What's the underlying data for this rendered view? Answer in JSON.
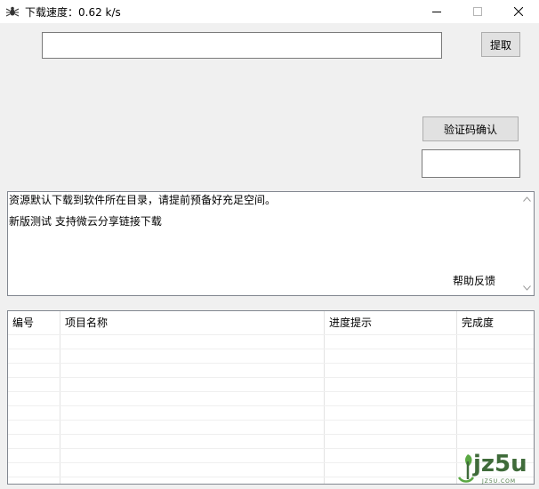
{
  "window": {
    "title": "下载速度：0.62 k/s",
    "icon": "spider-app-icon",
    "controls": [
      "minimize-icon",
      "maximize-icon",
      "close-icon"
    ]
  },
  "top": {
    "url_value": "",
    "url_placeholder": "",
    "fetch_label": "提取"
  },
  "captcha": {
    "verify_label": "验证码确认",
    "input_value": ""
  },
  "log": {
    "lines": [
      "资源默认下载到软件所在目录，请提前预备好充足空间。",
      "新版测试 支持微云分享链接下载"
    ],
    "help_label": "帮助反馈"
  },
  "table": {
    "columns": [
      "编号",
      "项目名称",
      "进度提示",
      "完成度"
    ],
    "rows": []
  },
  "watermark": {
    "text": "jz5u",
    "small": "JZ5U.COM"
  },
  "colors": {
    "background": "#f0f0f0",
    "border": "#828790",
    "button": "#e1e1e1",
    "watermark_green": "#3f6b3a"
  }
}
